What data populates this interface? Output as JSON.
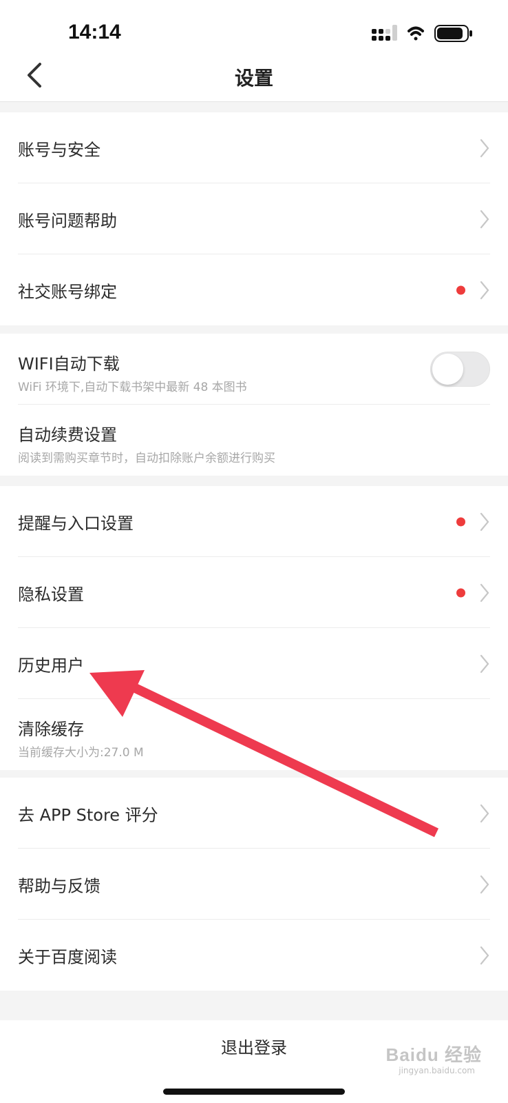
{
  "status_bar": {
    "time": "14:14"
  },
  "nav": {
    "title": "设置"
  },
  "groups": [
    {
      "items": [
        {
          "title": "账号与安全"
        },
        {
          "title": "账号问题帮助"
        },
        {
          "title": "社交账号绑定",
          "badge": true
        }
      ]
    },
    {
      "items": [
        {
          "title": "WIFI自动下载",
          "subtitle": "WiFi 环境下,自动下载书架中最新 48 本图书",
          "toggle_on": false
        },
        {
          "title": "自动续费设置",
          "subtitle": "阅读到需购买章节时，自动扣除账户余额进行购买"
        }
      ]
    },
    {
      "items": [
        {
          "title": "提醒与入口设置",
          "badge": true
        },
        {
          "title": "隐私设置",
          "badge": true
        },
        {
          "title": "历史用户"
        },
        {
          "title": "清除缓存",
          "subtitle": "当前缓存大小为:27.0 M"
        }
      ]
    },
    {
      "items": [
        {
          "title": "去 APP Store 评分"
        },
        {
          "title": "帮助与反馈"
        },
        {
          "title": "关于百度阅读"
        }
      ]
    }
  ],
  "logout": {
    "label": "退出登录"
  },
  "watermark": {
    "text": "Baidu 经验",
    "sub": "jingyan.baidu.com"
  },
  "colors": {
    "accent_red": "#ee3c3c",
    "arrow_red": "#ee3a4f"
  }
}
